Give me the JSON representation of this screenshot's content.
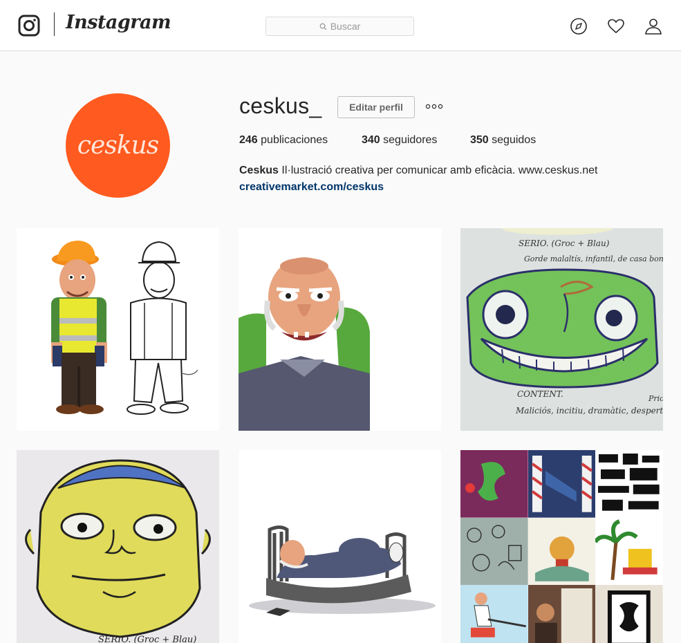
{
  "header": {
    "brand": "Instagram",
    "search_placeholder": "Buscar",
    "icons": [
      "instagram-logo-icon",
      "search-icon",
      "compass-icon",
      "heart-icon",
      "person-icon"
    ]
  },
  "profile": {
    "avatar_text": "ceskus",
    "username": "ceskus_",
    "edit_label": "Editar perfil",
    "stats": {
      "posts_count": "246",
      "posts_label": "publicaciones",
      "followers_count": "340",
      "followers_label": "seguidores",
      "following_count": "350",
      "following_label": "seguidos"
    },
    "bio_name": "Ceskus",
    "bio_text": "Il·lustració creativa per comunicar amb eficàcia. www.ceskus.net",
    "bio_link": "creativemarket.com/ceskus"
  },
  "posts": {
    "sketch3_line1": "SERIO. (Groc + Blau)",
    "sketch3_line2": "Gorde malaltís, infantil, de casa bona",
    "sketch3_line3": "CONTENT.",
    "sketch3_line4": "Maliciós, incitiu, dramàtic, despertador",
    "sketch3_side": "Prio",
    "sketch4_line": "SERIO. (Groc + Blau)"
  },
  "colors": {
    "avatar": "#ff5a1f",
    "link": "#003569",
    "border": "#dbdbdb",
    "background": "#fafafa"
  }
}
